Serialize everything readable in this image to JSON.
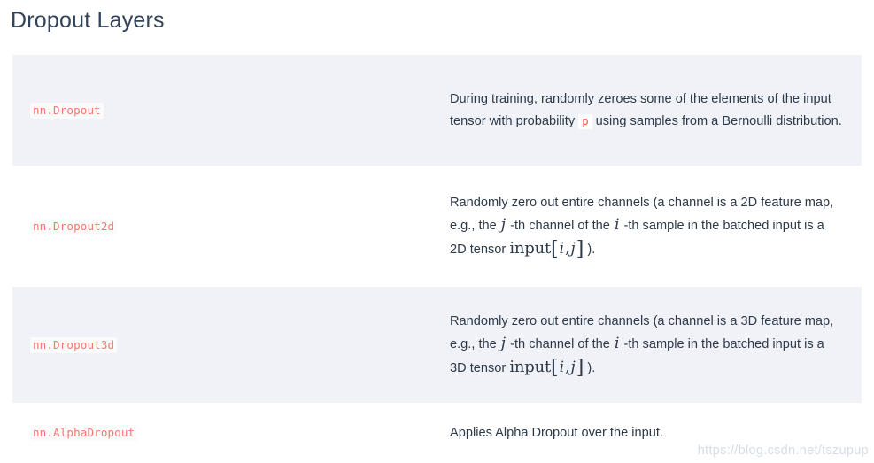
{
  "section": {
    "title": "Dropout Layers"
  },
  "colors": {
    "code_red": "#f8766d",
    "inline_code_red": "#fb4d3d",
    "row_stripe": "#f1f2f7",
    "row_plain": "#ffffff",
    "title_text": "#32435a",
    "body_text": "#2d3a4a",
    "watermark": "#d6dde6"
  },
  "rows": [
    {
      "name": "nn.Dropout",
      "description_parts": [
        {
          "type": "text",
          "value": "During training, randomly zeroes some of the elements of the input tensor with probability "
        },
        {
          "type": "code",
          "value": "p"
        },
        {
          "type": "text",
          "value": " using samples from a Bernoulli distribution."
        }
      ],
      "description_plain": "During training, randomly zeroes some of the elements of the input tensor with probability p using samples from a Bernoulli distribution."
    },
    {
      "name": "nn.Dropout2d",
      "description_parts": [
        {
          "type": "text",
          "value": "Randomly zero out entire channels (a channel is a 2D feature map, e.g., the "
        },
        {
          "type": "math",
          "value": "j"
        },
        {
          "type": "text",
          "value": " -th channel of the "
        },
        {
          "type": "math",
          "value": "i"
        },
        {
          "type": "text",
          "value": " -th sample in the batched input is a 2D tensor "
        },
        {
          "type": "math",
          "value": "input[i, j]"
        },
        {
          "type": "text",
          "value": " )."
        }
      ],
      "description_plain": "Randomly zero out entire channels (a channel is a 2D feature map, e.g., the j -th channel of the i -th sample in the batched input is a 2D tensor input[i, j] )."
    },
    {
      "name": "nn.Dropout3d",
      "description_parts": [
        {
          "type": "text",
          "value": "Randomly zero out entire channels (a channel is a 3D feature map, e.g., the "
        },
        {
          "type": "math",
          "value": "j"
        },
        {
          "type": "text",
          "value": " -th channel of the "
        },
        {
          "type": "math",
          "value": "i"
        },
        {
          "type": "text",
          "value": " -th sample in the batched input is a 3D tensor "
        },
        {
          "type": "math",
          "value": "input[i, j]"
        },
        {
          "type": "text",
          "value": " )."
        }
      ],
      "description_plain": "Randomly zero out entire channels (a channel is a 3D feature map, e.g., the j -th channel of the i -th sample in the batched input is a 3D tensor input[i, j] )."
    },
    {
      "name": "nn.AlphaDropout",
      "description_parts": [
        {
          "type": "text",
          "value": "Applies Alpha Dropout over the input."
        }
      ],
      "description_plain": "Applies Alpha Dropout over the input."
    }
  ],
  "row_text": {
    "r1_seg1": "During training, randomly zeroes some of the elements of the input tensor with probability ",
    "r1_code": "p",
    "r1_seg2": " using samples from a Bernoulli distribution.",
    "r2_seg1": "Randomly zero out entire channels (a channel is a 2D feature map, e.g., the ",
    "r2_j": "j",
    "r2_seg2": " -th channel of the ",
    "r2_i": "i",
    "r2_seg3": " -th sample in the batched input is a 2D tensor ",
    "r2_input": "input",
    "r2_lb": "[",
    "r2_mi": "i",
    "r2_comma": ",",
    "r2_mj": "j",
    "r2_rb": "]",
    "r2_seg4": " ).",
    "r3_seg1": "Randomly zero out entire channels (a channel is a 3D feature map, e.g., the ",
    "r3_j": "j",
    "r3_seg2": " -th channel of the ",
    "r3_i": "i",
    "r3_seg3": " -th sample in the batched input is a 3D tensor ",
    "r3_input": "input",
    "r3_lb": "[",
    "r3_mi": "i",
    "r3_comma": ",",
    "r3_mj": "j",
    "r3_rb": "]",
    "r3_seg4": " ).",
    "r4_seg1": "Applies Alpha Dropout over the input."
  },
  "watermark": {
    "text": "https://blog.csdn.net/tszupup"
  }
}
